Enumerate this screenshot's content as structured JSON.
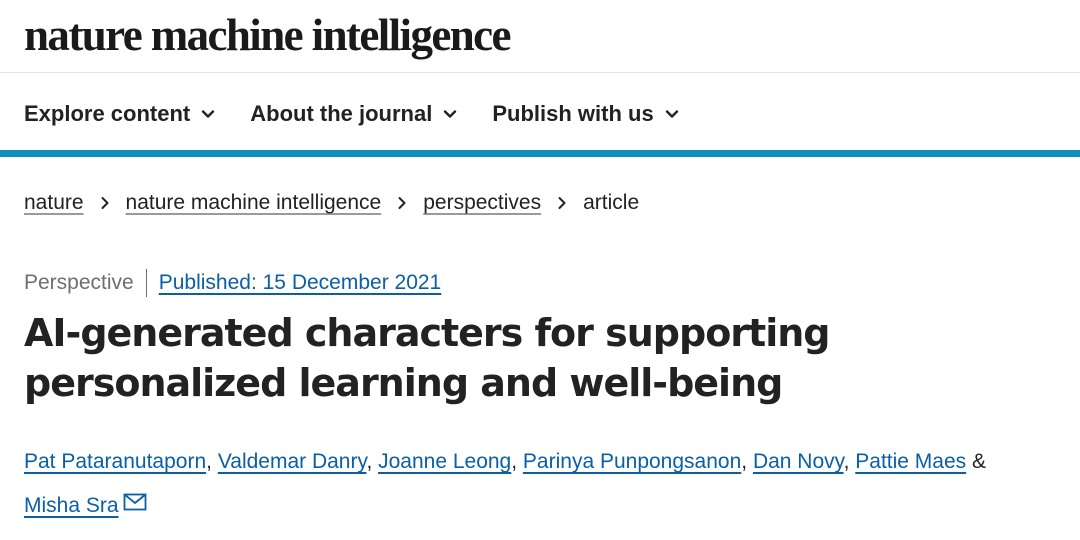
{
  "site": {
    "logo_text": "nature machine intelligence"
  },
  "nav": {
    "items": [
      {
        "label": "Explore content"
      },
      {
        "label": "About the journal"
      },
      {
        "label": "Publish with us"
      }
    ]
  },
  "breadcrumb": {
    "items": [
      {
        "label": "nature"
      },
      {
        "label": "nature machine intelligence"
      },
      {
        "label": "perspectives"
      }
    ],
    "current": "article"
  },
  "article": {
    "type": "Perspective",
    "published": "Published: 15 December 2021",
    "title_line1": "AI-generated characters for supporting",
    "title_line2": "personalized learning and well-being",
    "authors": [
      "Pat Pataranutaporn",
      "Valdemar Danry",
      "Joanne Leong",
      "Parinya Punpongsanon",
      "Dan Novy",
      "Pattie Maes",
      "Misha Sra"
    ],
    "author_separator": ", ",
    "last_author_conjunction": " & "
  },
  "colors": {
    "accent_bar": "#0f8fbc",
    "link": "#0b5fa5",
    "muted": "#6f6f6f"
  },
  "icons": {
    "nav_chevron": "chevron-down-icon",
    "breadcrumb_separator": "chevron-right-icon",
    "corresponding_author": "mail-icon"
  }
}
